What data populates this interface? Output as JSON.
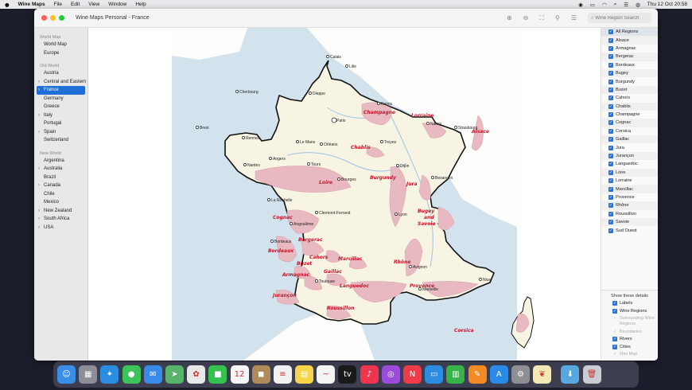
{
  "menubar": {
    "apple": "",
    "app_name": "Wine Maps",
    "items": [
      "File",
      "Edit",
      "View",
      "Window",
      "Help"
    ],
    "clock": "Thu 12 Oct  20:58"
  },
  "window": {
    "title": "Wine Maps Personal - France",
    "search_placeholder": "Wine Region Search"
  },
  "sidebar": {
    "sections": [
      {
        "title": "World Map",
        "items": [
          {
            "label": "World Map",
            "chevron": false
          },
          {
            "label": "Europe",
            "chevron": false
          }
        ]
      },
      {
        "title": "Old World",
        "items": [
          {
            "label": "Austria",
            "chevron": false
          },
          {
            "label": "Central and Eastern Europe",
            "chevron": true
          },
          {
            "label": "France",
            "chevron": true,
            "selected": true
          },
          {
            "label": "Germany",
            "chevron": false
          },
          {
            "label": "Greece",
            "chevron": false
          },
          {
            "label": "Italy",
            "chevron": true
          },
          {
            "label": "Portugal",
            "chevron": false
          },
          {
            "label": "Spain",
            "chevron": true
          },
          {
            "label": "Switzerland",
            "chevron": false
          }
        ]
      },
      {
        "title": "New World",
        "items": [
          {
            "label": "Argentina",
            "chevron": false
          },
          {
            "label": "Australia",
            "chevron": true
          },
          {
            "label": "Brazil",
            "chevron": false
          },
          {
            "label": "Canada",
            "chevron": true
          },
          {
            "label": "Chile",
            "chevron": false
          },
          {
            "label": "Mexico",
            "chevron": false
          },
          {
            "label": "New Zealand",
            "chevron": true
          },
          {
            "label": "South Africa",
            "chevron": true
          },
          {
            "label": "USA",
            "chevron": true
          }
        ]
      }
    ]
  },
  "regions_list": [
    "All Regions",
    "Alsace",
    "Armagnac",
    "Bergerac",
    "Bordeaux",
    "Bugey",
    "Burgundy",
    "Buzet",
    "Cahors",
    "Chablis",
    "Champagne",
    "Cognac",
    "Corsica",
    "Gaillac",
    "Jura",
    "Jurançon",
    "Languedoc",
    "Loire",
    "Lorraine",
    "Marcillac",
    "Provence",
    "Rhône",
    "Roussillon",
    "Savoie",
    "Sud Ouest"
  ],
  "details": {
    "header": "Show these details",
    "items": [
      {
        "label": "Labels",
        "checked": true,
        "enabled": true
      },
      {
        "label": "Wine Regions",
        "checked": true,
        "enabled": true
      },
      {
        "label": "Surrounding Wine Regions",
        "checked": true,
        "enabled": false
      },
      {
        "label": "Boundaries",
        "checked": true,
        "enabled": false
      },
      {
        "label": "Rivers",
        "checked": true,
        "enabled": true
      },
      {
        "label": "Cities",
        "checked": true,
        "enabled": true
      },
      {
        "label": "Mini Map",
        "checked": true,
        "enabled": false
      }
    ]
  },
  "map": {
    "colors": {
      "sea": "#d2e3ee",
      "land": "#f7f4e4",
      "region": "#e8b9c1",
      "region_label": "#c0192e"
    },
    "region_labels": [
      {
        "id": "champagne",
        "text": "Champagne"
      },
      {
        "id": "lorraine",
        "text": "Lorraine"
      },
      {
        "id": "alsace",
        "text": "Alsace"
      },
      {
        "id": "chablis",
        "text": "Chablis"
      },
      {
        "id": "burgundy",
        "text": "Burgundy"
      },
      {
        "id": "loire",
        "text": "Loire"
      },
      {
        "id": "jura",
        "text": "Jura"
      },
      {
        "id": "bugey",
        "text": "Bugey"
      },
      {
        "id": "and",
        "text": "and"
      },
      {
        "id": "savoie",
        "text": "Savoie"
      },
      {
        "id": "cognac",
        "text": "Cognac"
      },
      {
        "id": "bergerac",
        "text": "Bergerac"
      },
      {
        "id": "bordeaux",
        "text": "Bordeaux"
      },
      {
        "id": "cahors",
        "text": "Cahors"
      },
      {
        "id": "buzet",
        "text": "Buzet"
      },
      {
        "id": "marcillac",
        "text": "Marcillac"
      },
      {
        "id": "rhone",
        "text": "Rhône"
      },
      {
        "id": "gaillac",
        "text": "Gaillac"
      },
      {
        "id": "armagnac",
        "text": "Armagnac"
      },
      {
        "id": "languedoc",
        "text": "Languedoc"
      },
      {
        "id": "provence",
        "text": "Provence"
      },
      {
        "id": "jurancon",
        "text": "Jurançon"
      },
      {
        "id": "roussillon",
        "text": "Roussillon"
      },
      {
        "id": "corsica",
        "text": "Corsica"
      }
    ],
    "cities": [
      {
        "id": "calais",
        "text": "Calais"
      },
      {
        "id": "lille",
        "text": "Lille"
      },
      {
        "id": "cherbourg",
        "text": "Cherbourg"
      },
      {
        "id": "dieppe",
        "text": "Dieppe"
      },
      {
        "id": "reims",
        "text": "Reims"
      },
      {
        "id": "paris",
        "text": "Paris"
      },
      {
        "id": "nancy",
        "text": "Nancy"
      },
      {
        "id": "strasbourg",
        "text": "Strasbourg"
      },
      {
        "id": "brest",
        "text": "Brest"
      },
      {
        "id": "rennes",
        "text": "Rennes"
      },
      {
        "id": "lemans",
        "text": "Le Mans"
      },
      {
        "id": "orleans",
        "text": "Orléans"
      },
      {
        "id": "troyes",
        "text": "Troyes"
      },
      {
        "id": "angers",
        "text": "Angers"
      },
      {
        "id": "tours",
        "text": "Tours"
      },
      {
        "id": "nantes",
        "text": "Nantes"
      },
      {
        "id": "dijon",
        "text": "Dijon"
      },
      {
        "id": "bourges",
        "text": "Bourges"
      },
      {
        "id": "besancon",
        "text": "Besançon"
      },
      {
        "id": "larochelle",
        "text": "La Rochelle"
      },
      {
        "id": "clermont",
        "text": "Clermont-Ferrand"
      },
      {
        "id": "lyon",
        "text": "Lyon"
      },
      {
        "id": "angouleme",
        "text": "Angoulême"
      },
      {
        "id": "bordeauxcity",
        "text": "Bordeaux"
      },
      {
        "id": "avignon",
        "text": "Avignon"
      },
      {
        "id": "nice",
        "text": "Nice"
      },
      {
        "id": "toulouse",
        "text": "Toulouse"
      },
      {
        "id": "marseille",
        "text": "Marseille"
      }
    ]
  },
  "dock": {
    "apps": [
      {
        "name": "finder",
        "glyph": "☺",
        "color": "#3a8ee6"
      },
      {
        "name": "launchpad",
        "glyph": "▦",
        "color": "#8d8d96"
      },
      {
        "name": "safari",
        "glyph": "✦",
        "color": "#2b8de0"
      },
      {
        "name": "messages",
        "glyph": "●",
        "color": "#3cc45b"
      },
      {
        "name": "mail",
        "glyph": "✉",
        "color": "#3a8ae8"
      },
      {
        "name": "maps",
        "glyph": "➤",
        "color": "#58b36b"
      },
      {
        "name": "photos",
        "glyph": "✿",
        "color": "#e8e8e8"
      },
      {
        "name": "facetime",
        "glyph": "■",
        "color": "#34c24f"
      },
      {
        "name": "calendar",
        "glyph": "12",
        "color": "#f5f5f5"
      },
      {
        "name": "contacts",
        "glyph": "◼",
        "color": "#b08a5a"
      },
      {
        "name": "reminders",
        "glyph": "≡",
        "color": "#f1f1f1"
      },
      {
        "name": "notes",
        "glyph": "▤",
        "color": "#f6d54b"
      },
      {
        "name": "freeform",
        "glyph": "~",
        "color": "#f4f4f4"
      },
      {
        "name": "tv",
        "glyph": "tv",
        "color": "#1a1a1a"
      },
      {
        "name": "music",
        "glyph": "♪",
        "color": "#f0344f"
      },
      {
        "name": "podcasts",
        "glyph": "◎",
        "color": "#9a4bd8"
      },
      {
        "name": "news",
        "glyph": "N",
        "color": "#f03a46"
      },
      {
        "name": "keynote",
        "glyph": "▭",
        "color": "#2c8ce0"
      },
      {
        "name": "numbers",
        "glyph": "▥",
        "color": "#37b34a"
      },
      {
        "name": "pages",
        "glyph": "✎",
        "color": "#f28b24"
      },
      {
        "name": "app-store",
        "glyph": "A",
        "color": "#2a8ae6"
      },
      {
        "name": "system-settings",
        "glyph": "⚙",
        "color": "#8e8e93"
      },
      {
        "name": "wine-maps",
        "glyph": "❦",
        "color": "#f2e7b5"
      },
      {
        "name": "downloads",
        "glyph": "⬇",
        "color": "#58a8e0"
      },
      {
        "name": "trash",
        "glyph": "🗑",
        "color": "#c9ccd2"
      }
    ]
  }
}
